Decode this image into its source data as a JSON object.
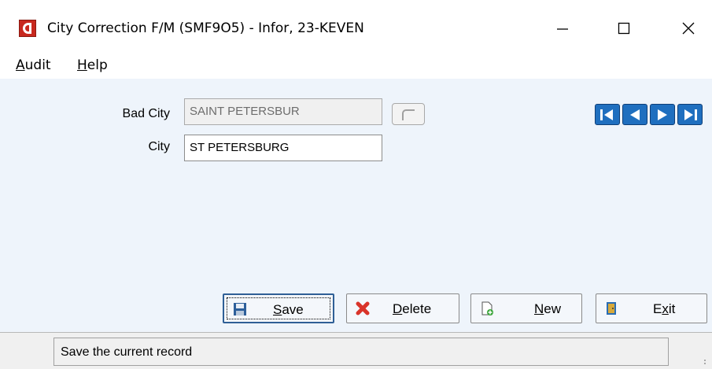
{
  "window": {
    "title": "City Correction F/M (SMF9O5) - Infor, 23-KEVEN",
    "icon": "app-logo-icon",
    "controls": [
      "minimize-icon",
      "maximize-icon",
      "close-icon"
    ]
  },
  "menu": {
    "audit": {
      "mnemonic": "A",
      "rest": "udit"
    },
    "help": {
      "mnemonic": "H",
      "rest": "elp"
    }
  },
  "form": {
    "bad_city_label": "Bad City",
    "bad_city_value": "SAINT PETERSBUR",
    "city_label": "City",
    "city_value": "ST PETERSBURG"
  },
  "navigation": [
    "first-record-icon",
    "previous-record-icon",
    "next-record-icon",
    "last-record-icon"
  ],
  "buttons": {
    "save": {
      "mnemonic": "S",
      "rest": "ave",
      "icon": "floppy-disk-icon"
    },
    "delete": {
      "mnemonic": "D",
      "rest": "elete",
      "icon": "red-x-icon"
    },
    "new": {
      "mnemonic": "N",
      "rest": "ew",
      "icon": "new-document-icon"
    },
    "exit": {
      "prefix": "E",
      "mnemonic": "x",
      "rest": "it",
      "icon": "exit-door-icon"
    }
  },
  "status": {
    "message": "Save the current record"
  },
  "colors": {
    "client_bg": "#eef4fb",
    "nav_blue": "#1f6fbf",
    "app_icon_red": "#c8281e"
  }
}
